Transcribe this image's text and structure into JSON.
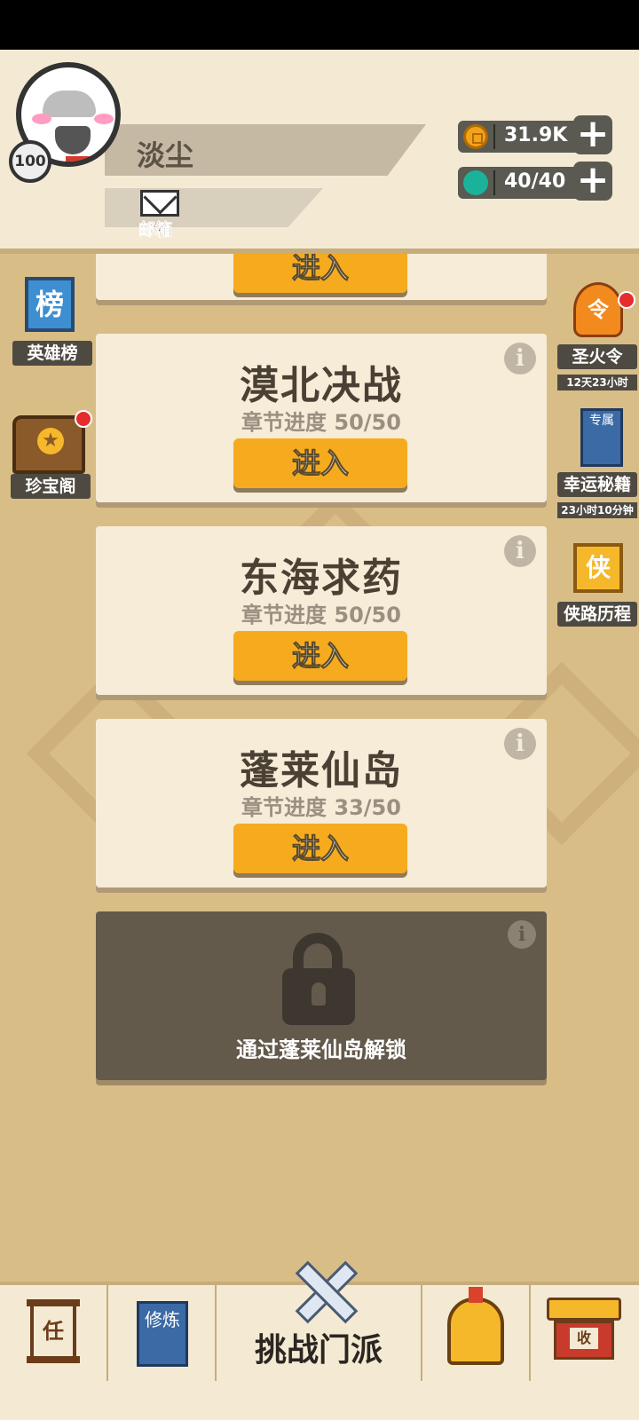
{
  "header": {
    "player_name": "淡尘",
    "level": "100",
    "mail_label": "邮箱",
    "coins": "31.9K",
    "energy": "40/40"
  },
  "chapters": [
    {
      "title": "",
      "enter_label": "进入"
    },
    {
      "title": "漠北决战",
      "progress": "章节进度 50/50",
      "enter_label": "进入"
    },
    {
      "title": "东海求药",
      "progress": "章节进度 50/50",
      "enter_label": "进入"
    },
    {
      "title": "蓬莱仙岛",
      "progress": "章节进度 33/50",
      "enter_label": "进入"
    }
  ],
  "locked": {
    "text": "通过蓬莱仙岛解锁"
  },
  "left_side": [
    {
      "label": "英雄榜",
      "icon_char": "榜"
    },
    {
      "label": "珍宝阁"
    }
  ],
  "right_side": [
    {
      "label": "圣火令",
      "sub": "12天23小时",
      "icon_char": "令"
    },
    {
      "label": "幸运秘籍",
      "sub": "23小时10分钟",
      "icon_char": "专属"
    },
    {
      "label": "侠路历程",
      "icon_char": "侠"
    }
  ],
  "bottom_nav": {
    "task_char": "任",
    "cultivate_chars": "修炼",
    "center_label": "挑战门派",
    "hall_char": "收"
  },
  "info_glyph": "i"
}
